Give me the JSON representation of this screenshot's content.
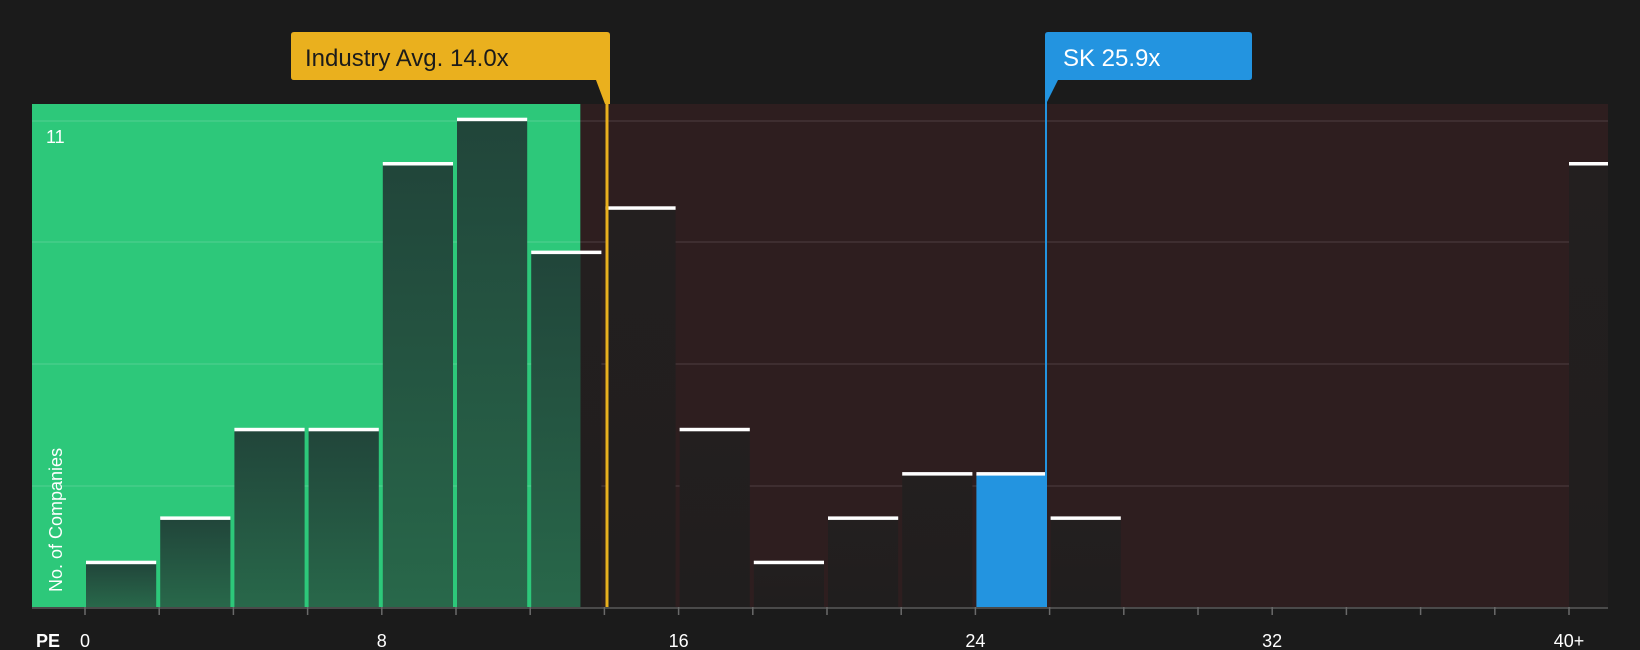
{
  "chart_data": {
    "type": "bar",
    "x_axis_label": "PE",
    "y_axis_label": "No. of Companies",
    "y_top_tick": "11",
    "x_ticks": [
      "0",
      "8",
      "16",
      "24",
      "32",
      "40+"
    ],
    "bin_width": 2,
    "bins": [
      {
        "start": 0,
        "count": 1
      },
      {
        "start": 2,
        "count": 2
      },
      {
        "start": 4,
        "count": 4
      },
      {
        "start": 6,
        "count": 4
      },
      {
        "start": 8,
        "count": 10
      },
      {
        "start": 10,
        "count": 11
      },
      {
        "start": 12,
        "count": 8
      },
      {
        "start": 14,
        "count": 9
      },
      {
        "start": 16,
        "count": 4
      },
      {
        "start": 18,
        "count": 1
      },
      {
        "start": 20,
        "count": 2
      },
      {
        "start": 22,
        "count": 3
      },
      {
        "start": 24,
        "count": 3
      },
      {
        "start": 26,
        "count": 2
      },
      {
        "start": 28,
        "count": 0
      },
      {
        "start": 30,
        "count": 0
      },
      {
        "start": 32,
        "count": 0
      },
      {
        "start": 34,
        "count": 0
      },
      {
        "start": 36,
        "count": 0
      },
      {
        "start": 38,
        "count": 0
      },
      {
        "start": 40,
        "count": 10
      }
    ],
    "x_range": [
      0,
      40
    ],
    "y_range": [
      0,
      11
    ],
    "industry_avg": {
      "label": "Industry Avg. 14.0x",
      "value": 14.0
    },
    "company": {
      "label": "SK 25.9x",
      "value": 25.9
    },
    "colors": {
      "undervalued_zone": "#2dc87a",
      "overvalued_zone": "#2e1e1f",
      "bar_dark": "#244a39",
      "bar_dark_right": "#221e1e",
      "bar_highlight": "#2394e0",
      "industry": "#eab01e",
      "company": "#2394e0",
      "background": "#1b1b1b"
    }
  }
}
